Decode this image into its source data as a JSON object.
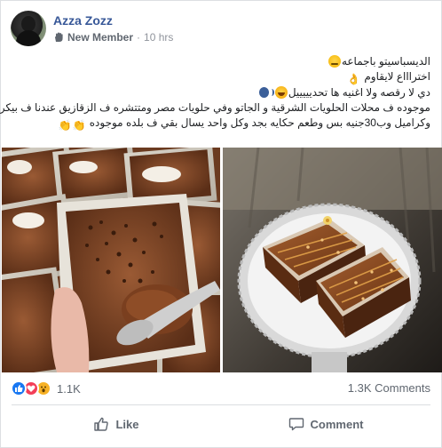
{
  "post": {
    "author": "Azza Zozz",
    "badge": "New Member",
    "time": "10 hrs",
    "lines": [
      "الديسباسيتو باجماعه",
      "اختراااع لايقاوم",
      "دي لا رقصه ولا اغنيه ها تحديييييل",
      "موجوده ف محلات الحلويات الشرقية و الجاتو وفي حلويات مصر ومتتشره ف الزقازيق عندنا ف بيكري",
      "وكراميل وب30جنيه بس وطعم حكايه بجد وكل واحد يسال بقي ف بلده موجوده"
    ]
  },
  "icons": {
    "badge_icon": "hand-wave-icon",
    "like_reaction": "like-reaction-icon",
    "love_reaction": "love-reaction-icon",
    "wow_reaction": "wow-reaction-icon",
    "like_action": "thumbs-up-icon",
    "comment_action": "speech-bubble-icon"
  },
  "stats": {
    "reactions": "1.1K",
    "comments": "1.3K Comments"
  },
  "actions": {
    "like": "Like",
    "comment": "Comment"
  },
  "colors": {
    "author": "#385898",
    "like_blue": "#1877f2",
    "love_red": "#f33e58",
    "wow_yellow": "#f7b125",
    "muted": "#606770"
  }
}
